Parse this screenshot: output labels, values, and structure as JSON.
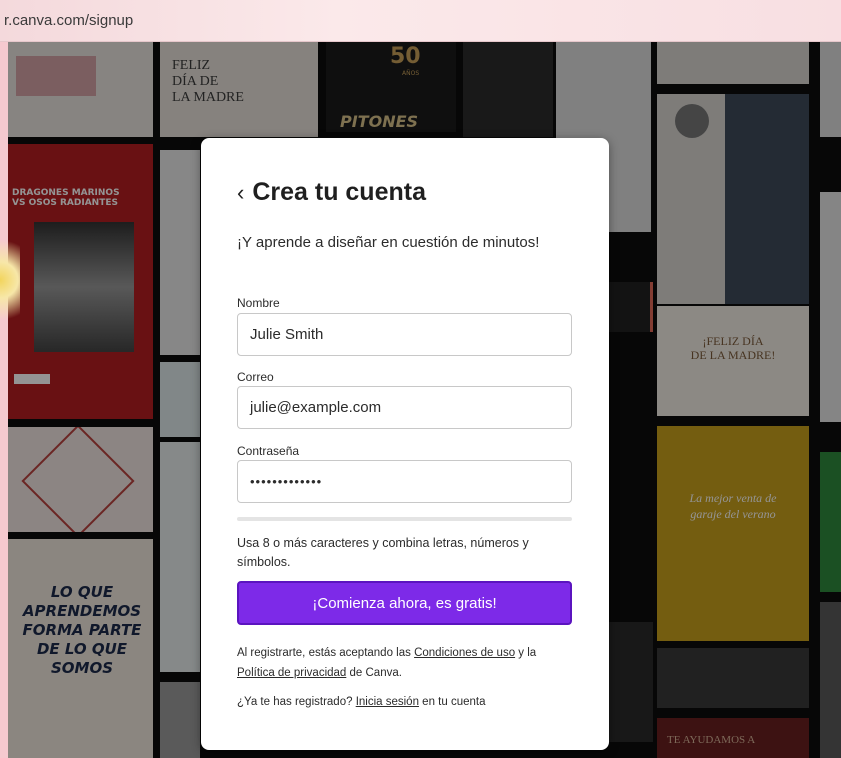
{
  "browser": {
    "url": "r.canva.com/signup"
  },
  "background": {
    "tiles": [
      {
        "text": "FELIZ\nDÍA DE\nLA MADRE"
      },
      {
        "text": "50"
      },
      {
        "text": "AÑOS"
      },
      {
        "text": "PITONES"
      },
      {
        "text": "DRAGONES MARINOS\nVS OSOS RADIANTES"
      },
      {
        "text": "¡FELIZ DÍA\nDE LA MADRE!"
      },
      {
        "text": "La mejor venta de\ngaraje del verano"
      },
      {
        "text": "LO QUE\nAPRENDEMOS\nFORMA PARTE\nDE LO QUE\nSOMOS"
      },
      {
        "text": "TE AYUDAMOS A"
      }
    ]
  },
  "modal": {
    "title": "Crea tu cuenta",
    "subtitle": "¡Y aprende a diseñar en cuestión de minutos!",
    "fields": {
      "name": {
        "label": "Nombre",
        "value": "Julie Smith"
      },
      "email": {
        "label": "Correo",
        "value": "julie@example.com"
      },
      "password": {
        "label": "Contraseña",
        "value": "•••••••••••••"
      }
    },
    "password_hint": "Usa 8 o más caracteres y combina letras, números y símbolos.",
    "cta_label": "¡Comienza ahora, es gratis!",
    "legal": {
      "prefix": "Al registrarte, estás aceptando las ",
      "terms_link": "Condiciones de uso",
      "middle": " y la ",
      "privacy_link": "Política de privacidad",
      "suffix": " de Canva."
    },
    "login": {
      "prefix": "¿Ya te has registrado? ",
      "link": "Inicia sesión",
      "suffix": " en tu cuenta"
    }
  }
}
